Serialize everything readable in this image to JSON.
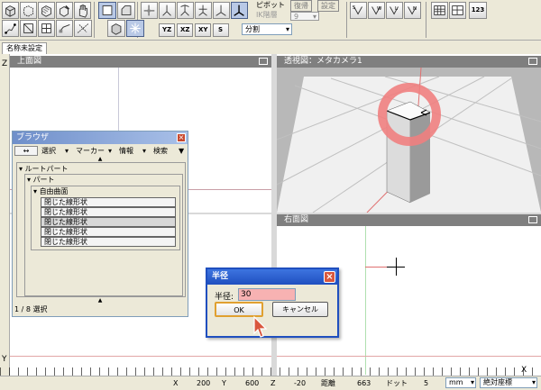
{
  "toolbar": {
    "pivot_label": "ピボット",
    "ik_label": "IK階層",
    "ik_value": "9",
    "reset_label": "復帰",
    "settings_label": "設定",
    "split_value": "分割",
    "counter_label": "123"
  },
  "document": {
    "tab_title": "名称未設定"
  },
  "viewports": {
    "top": {
      "title": "上面図"
    },
    "perspective": {
      "title": "透視図：メタカメラ1"
    },
    "right": {
      "title": "右面図"
    }
  },
  "browser": {
    "title": "ブラウザ",
    "menu": [
      "選択",
      "マーカー",
      "情報",
      "検索"
    ],
    "tree": {
      "root": "ルートパート",
      "part": "パート",
      "surface": "自由曲面",
      "items": [
        "閉じた線形状",
        "閉じた線形状",
        "閉じた線形状",
        "閉じた線形状",
        "閉じた線形状"
      ]
    },
    "status": "1 / 8 選択"
  },
  "dialog": {
    "title": "半径",
    "label": "半径:",
    "value": "30",
    "ok_label": "OK",
    "cancel_label": "キャンセル"
  },
  "axes": {
    "z": "Z",
    "y": "Y",
    "x": "X"
  },
  "statusbar": {
    "x_label": "X",
    "x_value": "200",
    "y_label": "Y",
    "y_value": "600",
    "z_label": "Z",
    "z_value": "-20",
    "dist_label": "距離",
    "dist_value": "663",
    "dot_label": "ドット",
    "dot_value": "5",
    "unit_value": "mm",
    "coord_value": "絶対座標"
  },
  "colors": {
    "accent": "#0a246a",
    "dialog_title": "#1f4fbf",
    "selection": "#f08080",
    "window_close": "#c8492f"
  }
}
